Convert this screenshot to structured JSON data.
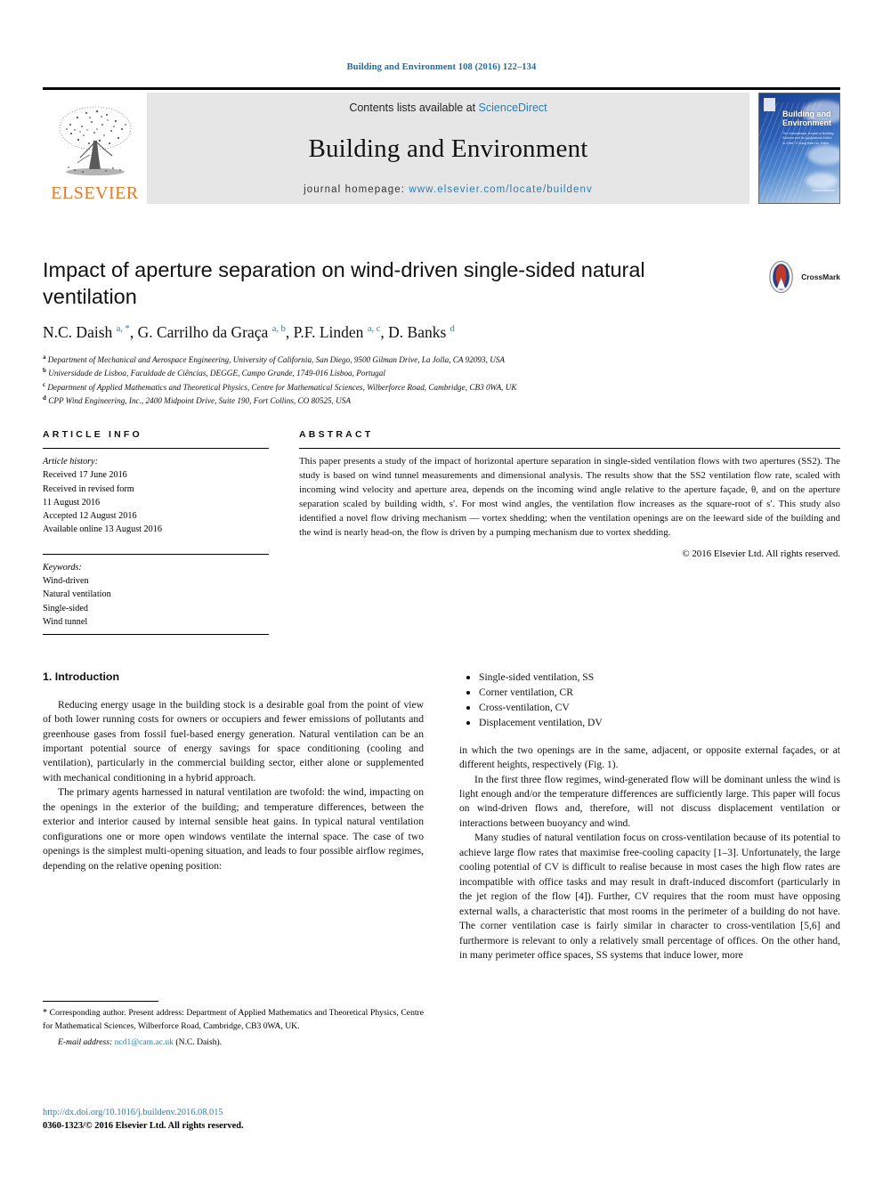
{
  "running_head": "Building and Environment 108 (2016) 122–134",
  "masthead": {
    "contents_prefix": "Contents lists available at ",
    "contents_link": "ScienceDirect",
    "journal_title": "Building and Environment",
    "homepage_prefix": "journal homepage: ",
    "homepage_url": "www.elsevier.com/locate/buildenv",
    "publisher_logo_text": "ELSEVIER",
    "cover": {
      "title_line1": "Building and",
      "title_line2": "Environment",
      "subtitle": "The International Journal of Building Science and its Applications\nEditor-in-Chief: Yi Jiang\nBeat Hu, Editor",
      "badge": "ScienceDirect"
    }
  },
  "article": {
    "title": "Impact of aperture separation on wind-driven single-sided natural ventilation",
    "crossmark_label": "CrossMark",
    "authors": [
      {
        "name": "N.C. Daish",
        "marks": "a, *"
      },
      {
        "name": "G. Carrilho da Graça",
        "marks": "a, b"
      },
      {
        "name": "P.F. Linden",
        "marks": "a, c"
      },
      {
        "name": "D. Banks",
        "marks": "d"
      }
    ],
    "affiliations": [
      {
        "mark": "a",
        "text": "Department of Mechanical and Aerospace Engineering, University of California, San Diego, 9500 Gilman Drive, La Jolla, CA 92093, USA"
      },
      {
        "mark": "b",
        "text": "Universidade de Lisboa, Faculdade de Ciências, DEGGE, Campo Grande, 1749-016 Lisboa, Portugal"
      },
      {
        "mark": "c",
        "text": "Department of Applied Mathematics and Theoretical Physics, Centre for Mathematical Sciences, Wilberforce Road, Cambridge, CB3 0WA, UK"
      },
      {
        "mark": "d",
        "text": "CPP Wind Engineering, Inc., 2400 Midpoint Drive, Suite 190, Fort Collins, CO 80525, USA"
      }
    ]
  },
  "article_info": {
    "heading": "ARTICLE INFO",
    "history_label": "Article history:",
    "history": [
      "Received 17 June 2016",
      "Received in revised form",
      "11 August 2016",
      "Accepted 12 August 2016",
      "Available online 13 August 2016"
    ],
    "keywords_label": "Keywords:",
    "keywords": [
      "Wind-driven",
      "Natural ventilation",
      "Single-sided",
      "Wind tunnel"
    ]
  },
  "abstract": {
    "heading": "ABSTRACT",
    "text": "This paper presents a study of the impact of horizontal aperture separation in single-sided ventilation flows with two apertures (SS2). The study is based on wind tunnel measurements and dimensional analysis. The results show that the SS2 ventilation flow rate, scaled with incoming wind velocity and aperture area, depends on the incoming wind angle relative to the aperture façade, θ, and on the aperture separation scaled by building width, s′. For most wind angles, the ventilation flow increases as the square-root of s′. This study also identified a novel flow driving mechanism — vortex shedding; when the ventilation openings are on the leeward side of the building and the wind is nearly head-on, the flow is driven by a pumping mechanism due to vortex shedding.",
    "rights": "© 2016 Elsevier Ltd. All rights reserved."
  },
  "body": {
    "section_title": "1. Introduction",
    "left_paragraphs": [
      "Reducing energy usage in the building stock is a desirable goal from the point of view of both lower running costs for owners or occupiers and fewer emissions of pollutants and greenhouse gases from fossil fuel-based energy generation. Natural ventilation can be an important potential source of energy savings for space conditioning (cooling and ventilation), particularly in the commercial building sector, either alone or supplemented with mechanical conditioning in a hybrid approach.",
      "The primary agents harnessed in natural ventilation are twofold: the wind, impacting on the openings in the exterior of the building; and temperature differences, between the exterior and interior caused by internal sensible heat gains. In typical natural ventilation configurations one or more open windows ventilate the internal space. The case of two openings is the simplest multi-opening situation, and leads to four possible airflow regimes, depending on the relative opening position:"
    ],
    "regimes": [
      "Single-sided ventilation, SS",
      "Corner ventilation, CR",
      "Cross-ventilation, CV",
      "Displacement ventilation, DV"
    ],
    "right_paragraphs": [
      "in which the two openings are in the same, adjacent, or opposite external façades, or at different heights, respectively (Fig. 1).",
      "In the first three flow regimes, wind-generated flow will be dominant unless the wind is light enough and/or the temperature differences are sufficiently large. This paper will focus on wind-driven flows and, therefore, will not discuss displacement ventilation or interactions between buoyancy and wind.",
      "Many studies of natural ventilation focus on cross-ventilation because of its potential to achieve large flow rates that maximise free-cooling capacity [1–3]. Unfortunately, the large cooling potential of CV is difficult to realise because in most cases the high flow rates are incompatible with office tasks and may result in draft-induced discomfort (particularly in the jet region of the flow [4]). Further, CV requires that the room must have opposing external walls, a characteristic that most rooms in the perimeter of a building do not have. The corner ventilation case is fairly similar in character to cross-ventilation [5,6] and furthermore is relevant to only a relatively small percentage of offices. On the other hand, in many perimeter office spaces, SS systems that induce lower, more"
    ]
  },
  "footer": {
    "corresponding_marker": "*",
    "corresponding_text": "Corresponding author. Present address: Department of Applied Mathematics and Theoretical Physics, Centre for Mathematical Sciences, Wilberforce Road, Cambridge, CB3 0WA, UK.",
    "email_label": "E-mail address:",
    "email": "ncd1@cam.ac.uk",
    "email_owner": "(N.C. Daish).",
    "doi": "http://dx.doi.org/10.1016/j.buildenv.2016.08.015",
    "issn_line": "0360-1323/© 2016 Elsevier Ltd. All rights reserved."
  },
  "colors": {
    "link": "#2a7db5",
    "ref": "#1a6ea8",
    "elsevier_orange": "#E87722",
    "masthead_gray": "#e6e6e6"
  }
}
